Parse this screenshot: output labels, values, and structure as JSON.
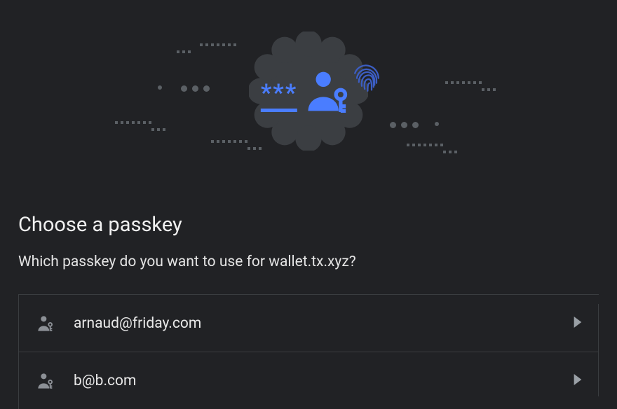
{
  "hero": {
    "asterisks": "***",
    "icons": {
      "password": "password-icon",
      "person": "person-key-icon",
      "fingerprint": "fingerprint-icon"
    }
  },
  "title": "Choose a passkey",
  "subtitle": "Which passkey do you want to use for wallet.tx.xyz?",
  "passkeys": [
    {
      "label": "arnaud@friday.com"
    },
    {
      "label": "b@b.com"
    }
  ],
  "colors": {
    "accent": "#4a7dff",
    "listIcon": "#8c9096"
  }
}
